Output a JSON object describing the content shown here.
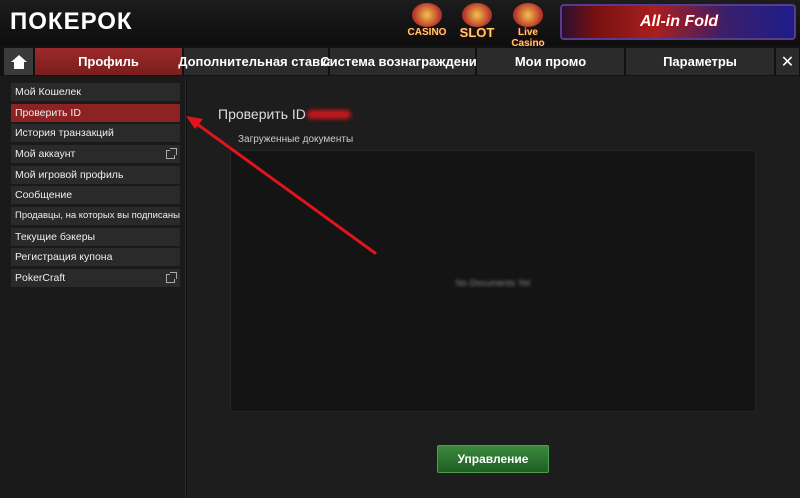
{
  "header": {
    "logo_text": "ПОКЕРОК",
    "games": [
      {
        "label": "CASINO",
        "icon": "casino-roulette-icon"
      },
      {
        "label": "SLOT",
        "icon": "slot-machine-icon"
      },
      {
        "label": "Live Casino",
        "icon": "live-casino-icon"
      }
    ],
    "banner_text": "All-in Fold"
  },
  "nav": {
    "home_icon": "home-icon",
    "tabs": [
      {
        "label": "Профиль",
        "active": true
      },
      {
        "label": "Дополнительная ставка",
        "active": false
      },
      {
        "label": "Система вознаграждений",
        "active": false
      },
      {
        "label": "Мои промо",
        "active": false
      },
      {
        "label": "Параметры",
        "active": false
      }
    ],
    "close_label": "✕"
  },
  "sidebar": {
    "items": [
      {
        "label": "Мой Кошелек",
        "active": false,
        "external": false
      },
      {
        "label": "Проверить ID",
        "active": true,
        "external": false
      },
      {
        "label": "История транзакций",
        "active": false,
        "external": false
      },
      {
        "label": "Мой аккаунт",
        "active": false,
        "external": true
      },
      {
        "label": "Мой игровой профиль",
        "active": false,
        "external": false
      },
      {
        "label": "Сообщение",
        "active": false,
        "external": false
      },
      {
        "label": "Продавцы, на которых вы подписаны",
        "active": false,
        "external": false
      },
      {
        "label": "Текущие бэкеры",
        "active": false,
        "external": false
      },
      {
        "label": "Регистрация купона",
        "active": false,
        "external": false
      },
      {
        "label": "PokerCraft",
        "active": false,
        "external": true
      }
    ]
  },
  "main": {
    "title": "Проверить ID",
    "docs_label": "Загруженные документы",
    "empty_text": "No Documents Yet",
    "manage_button": "Управление"
  },
  "colors": {
    "accent_red": "#8c2222",
    "button_green": "#2e7a33",
    "annotation_arrow": "#e0141b"
  }
}
